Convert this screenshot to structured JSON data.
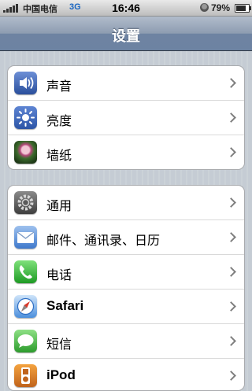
{
  "status_bar": {
    "carrier": "中国电信",
    "network": "3G",
    "time": "16:46",
    "battery_percent": "79%",
    "battery_level": 0.79,
    "signal_bars": 5
  },
  "nav": {
    "title": "设置"
  },
  "groups": [
    {
      "items": [
        {
          "label": "声音",
          "icon": "speaker-icon"
        },
        {
          "label": "亮度",
          "icon": "brightness-icon"
        },
        {
          "label": "墙纸",
          "icon": "wallpaper-icon"
        }
      ]
    },
    {
      "items": [
        {
          "label": "通用",
          "icon": "gear-icon"
        },
        {
          "label": "邮件、通讯录、日历",
          "icon": "mail-icon"
        },
        {
          "label": "电话",
          "icon": "phone-icon"
        },
        {
          "label": "Safari",
          "icon": "safari-compass-icon"
        },
        {
          "label": "短信",
          "icon": "messages-bubble-icon"
        },
        {
          "label": "iPod",
          "icon": "ipod-icon"
        }
      ]
    }
  ],
  "colors": {
    "nav_bar": "#6d83a2",
    "background": "#c5ccd4",
    "chevron": "#7f7f7f"
  }
}
